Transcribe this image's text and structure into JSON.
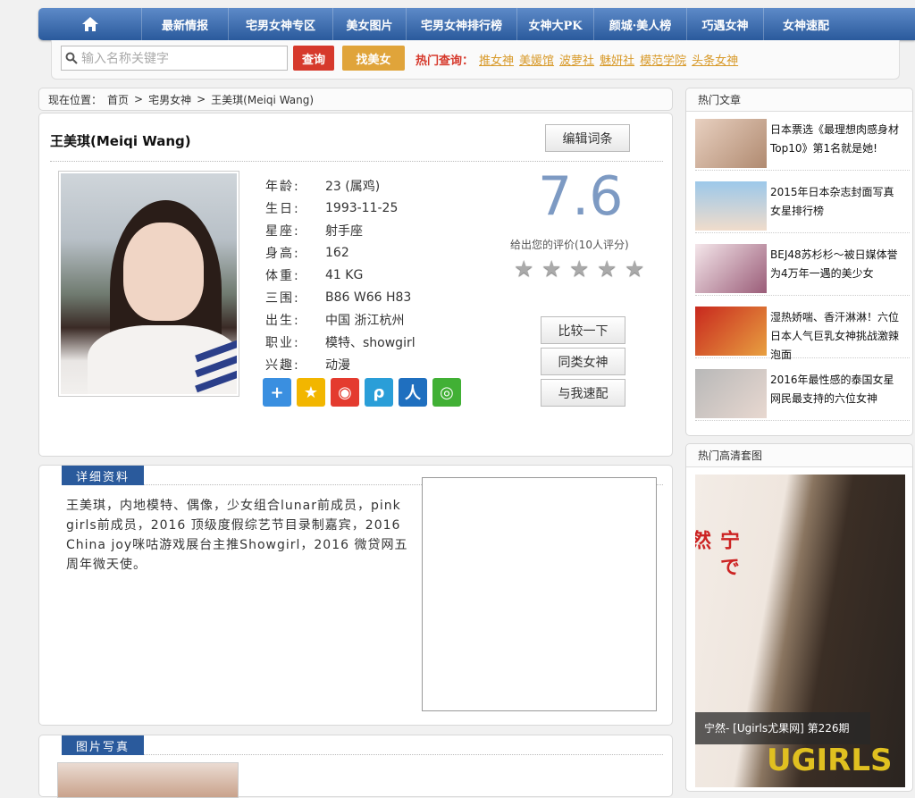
{
  "nav": {
    "items": [
      "最新情报",
      "宅男女神专区",
      "美女图片",
      "宅男女神排行榜",
      "女神大PK",
      "颜城·美人榜",
      "巧遇女神",
      "女神速配"
    ]
  },
  "search": {
    "placeholder": "输入名称关键字",
    "query_label": "查询",
    "find_label": "找美女",
    "hot_label": "热门查询：",
    "hot_links": [
      "推女神",
      "美媛馆",
      "波萝社",
      "魅妍社",
      "模范学院",
      "头条女神"
    ]
  },
  "breadcrumb": {
    "prefix": "现在位置：",
    "items": [
      "首页",
      "宅男女神",
      "王美琪(Meiqi Wang)"
    ],
    "sep": ">"
  },
  "profile": {
    "name": "王美琪(Meiqi Wang)",
    "edit_label": "编辑词条",
    "fields": [
      {
        "k": "年龄:",
        "v": "23 (属鸡)"
      },
      {
        "k": "生日:",
        "v": "1993-11-25"
      },
      {
        "k": "星座:",
        "v": "射手座"
      },
      {
        "k": "身高:",
        "v": "162"
      },
      {
        "k": "体重:",
        "v": "41 KG"
      },
      {
        "k": "三围:",
        "v": "B86 W66 H83"
      },
      {
        "k": "出生:",
        "v": "中国 浙江杭州"
      },
      {
        "k": "职业:",
        "v": "模特、showgirl"
      },
      {
        "k": "兴趣:",
        "v": "动漫"
      }
    ],
    "score": "7.6",
    "score_note": "给出您的评价(10人评分)",
    "rating_stars": 5,
    "buttons": [
      "比较一下",
      "同类女神",
      "与我速配"
    ]
  },
  "share_icons": [
    {
      "name": "plus-share-icon",
      "color": "#3a8fe0",
      "glyph": "+"
    },
    {
      "name": "qzone-share-icon",
      "color": "#f2b600",
      "glyph": "★"
    },
    {
      "name": "weibo-share-icon",
      "color": "#e43b2f",
      "glyph": "◉"
    },
    {
      "name": "tencent-weibo-share-icon",
      "color": "#2a9ed8",
      "glyph": "ρ"
    },
    {
      "name": "renren-share-icon",
      "color": "#1f6fbf",
      "glyph": "人"
    },
    {
      "name": "wechat-share-icon",
      "color": "#41b035",
      "glyph": "◎"
    }
  ],
  "detail": {
    "tab": "详细资料",
    "bio": "王美琪，内地模特、偶像，少女组合lunar前成员，pink girls前成员，2016 顶级度假综艺节目录制嘉宾，2016 China joy咪咕游戏展台主推Showgirl，2016 微贷网五周年微天使。"
  },
  "photos": {
    "tab": "图片写真"
  },
  "hot_articles": {
    "title": "热门文章",
    "items": [
      {
        "text": "日本票选《最理想肉感身材Top10》第1名就是她!"
      },
      {
        "text": "2015年日本杂志封面写真女星排行榜"
      },
      {
        "text": "BEJ48苏杉杉～被日媒体誉为4万年一遇的美少女"
      },
      {
        "text": "湿热娇喘、香汗淋淋！六位日本人气巨乳女神挑战激辣泡面"
      },
      {
        "text": "2016年最性感的泰国女星 网民最支持的六位女神"
      }
    ]
  },
  "hot_gallery": {
    "title": "热门高清套图",
    "caption": "宁然- [Ugirls尤果网] 第226期",
    "logo": "UGIRLS",
    "cover_text": "宁 で 然"
  }
}
